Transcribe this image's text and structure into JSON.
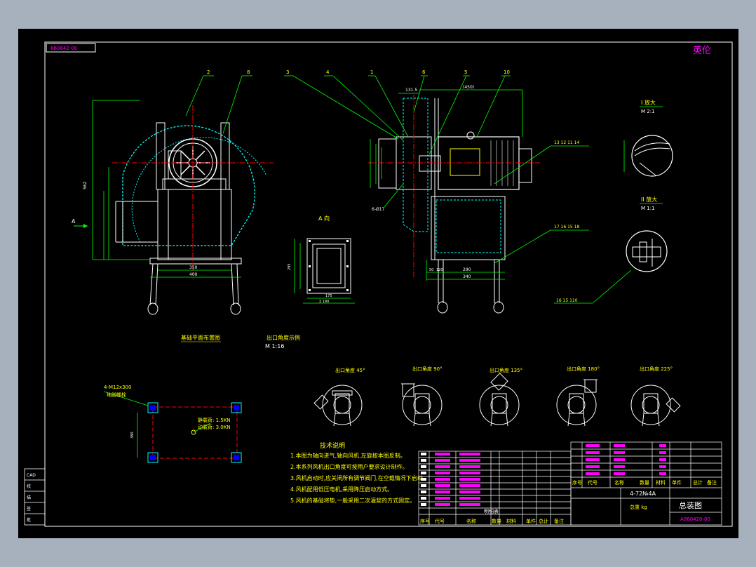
{
  "drawing": {
    "title_block_code_top": "860842-00",
    "drawing_name": "总装图",
    "drawing_number": "A860420-00",
    "corner_mark": "英伦",
    "model": "4-72№4A",
    "weight": "总重 kg"
  },
  "views": {
    "view_a_label": "A 向",
    "view_a_arrow": "A",
    "foundation_label": "基础平面布置图",
    "outlet_label": "出口角度示例",
    "outlet_scale": "M 1:16",
    "detail_i_label": "I 放大",
    "detail_i_scale": "M 2:1",
    "detail_ii_label": "II 放大",
    "detail_ii_scale": "M 1:1"
  },
  "callouts": {
    "top_numbers": [
      "2",
      "8",
      "3",
      "4",
      "1",
      "6",
      "5",
      "10"
    ],
    "side_group_1": "13 12 11 14",
    "side_group_2": "17 16 15 18",
    "bottom_group": "16 15 110"
  },
  "dimensions": {
    "main_width_1": "350",
    "main_width_2": "400",
    "main_height": "562",
    "side_dim_top": "131.5",
    "side_dim_motor": "(450)",
    "side_width_1": "290",
    "side_width_2": "340",
    "side_small_1": "50",
    "side_small_2": "120",
    "bolt_label": "6-Ø17",
    "flange_w1": "175",
    "flange_w2": "Σ  190",
    "flange_h": "295",
    "foundation_bolts": "4-M12x300",
    "foundation_bolt_note": "地脚螺栓",
    "foundation_dim": "380",
    "load_1": "静载荷: 1.5KN",
    "load_2": "动载荷: 3.0KN"
  },
  "outlet_angles": [
    {
      "label": "出口角度 45°"
    },
    {
      "label": "出口角度 90°"
    },
    {
      "label": "出口角度 135°"
    },
    {
      "label": "出口角度 180°"
    },
    {
      "label": "出口角度 225°"
    }
  ],
  "notes": {
    "heading": "技术说明",
    "items": [
      "1.本图为轴向进气,轴向风机,左旋按本图反制。",
      "2.本系列风机出口角度可按用户要求设计制作。",
      "3.风机启动时,应关闭所有调节阀门,在空载情况下启动。",
      "4.风机配用低压电机,采用降压启动方式。",
      "5.风机的基础将垫,一般采用二次灌浆的方式固定。"
    ]
  },
  "left_margin": {
    "rows": [
      "CAD",
      "校",
      "描",
      "签",
      "批"
    ]
  },
  "title_block": {
    "headers": [
      "序号",
      "代号",
      "名称",
      "数量",
      "材料",
      "单件",
      "总计",
      "备注"
    ],
    "mid_header": "明细表",
    "right_header": [
      "序号",
      "代号",
      "名称",
      "数量",
      "材料",
      "单件",
      "总计",
      "备注"
    ]
  }
}
